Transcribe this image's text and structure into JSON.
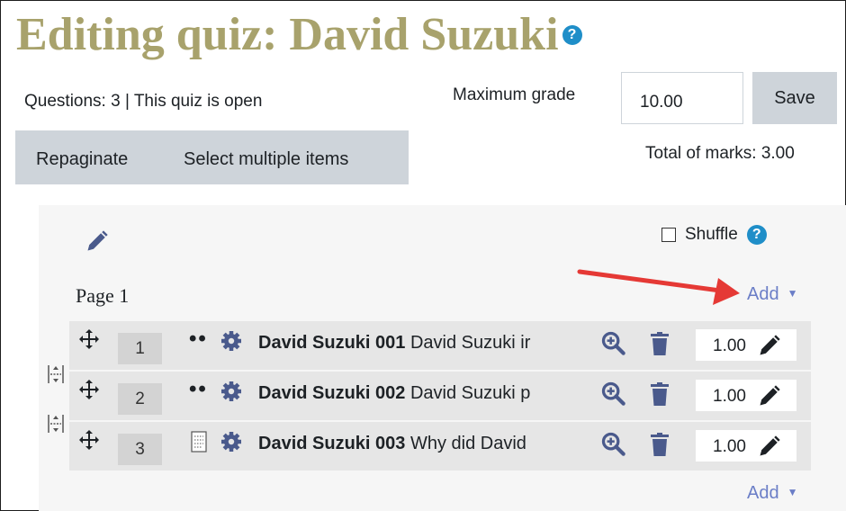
{
  "page": {
    "title": "Editing quiz: David Suzuki",
    "help_glyph": "?"
  },
  "summary": {
    "status": "Questions: 3 | This quiz is open",
    "max_grade_label": "Maximum grade",
    "max_grade_value": "10.00",
    "save_label": "Save",
    "total_marks": "Total of marks: 3.00"
  },
  "actions": {
    "repaginate": "Repaginate",
    "select_multiple": "Select multiple items"
  },
  "section": {
    "shuffle_label": "Shuffle",
    "shuffle_checked": false,
    "page_label": "Page 1",
    "add_label": "Add",
    "add_bottom_label": "Add"
  },
  "questions": [
    {
      "number": "1",
      "type_icon": "multichoice-dots-icon",
      "name": "David Suzuki 001",
      "text": "David Suzuki ir",
      "mark": "1.00"
    },
    {
      "number": "2",
      "type_icon": "multichoice-dots-icon",
      "name": "David Suzuki 002",
      "text": "David Suzuki p",
      "mark": "1.00"
    },
    {
      "number": "3",
      "type_icon": "essay-doc-icon",
      "name": "David Suzuki 003",
      "text": "Why did David",
      "mark": "1.00"
    }
  ],
  "colors": {
    "title": "#a8a26c",
    "help": "#1f8ec8",
    "link": "#6b7ec7",
    "arrow": "#e53935",
    "icon": "#4a5a8c",
    "button_grey": "#ced4da",
    "slot_bg": "#e6e6e6",
    "panel_bg": "#f6f6f6"
  }
}
